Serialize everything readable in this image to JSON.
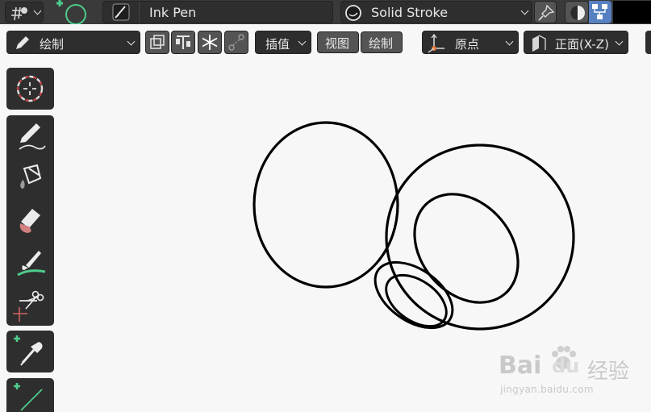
{
  "header": {
    "editor_icon": "grease-pencil-mode-icon",
    "object_icon": "add-circle-icon",
    "brush_icon": "ink-pen-brush-icon",
    "brush_name": "Ink Pen",
    "material_icon": "material-sphere-icon",
    "material_name": "Solid Stroke",
    "pin_icon": "pin-icon",
    "shading_icon": "shading-sphere-icon",
    "overlay_icon": "node-tree-icon"
  },
  "toolbar": {
    "mode_label": "绘制",
    "mode_icon": "pencil-icon",
    "interp_label": "插值",
    "view_label": "视图",
    "draw_label": "绘制",
    "origin_label": "原点",
    "plane_label": "正面(X-Z)"
  },
  "tools": [
    {
      "name": "cursor-tool",
      "icon": "cursor-icon"
    },
    {
      "name": "draw-tool",
      "icon": "pencil-icon"
    },
    {
      "name": "fill-tool",
      "icon": "bucket-icon"
    },
    {
      "name": "erase-tool",
      "icon": "eraser-icon"
    },
    {
      "name": "tint-tool",
      "icon": "brush-icon"
    },
    {
      "name": "cutter-tool",
      "icon": "scissors-icon"
    },
    {
      "name": "eyedropper-tool",
      "icon": "eyedropper-icon"
    },
    {
      "name": "line-tool",
      "icon": "line-icon"
    }
  ],
  "watermark": {
    "brand_left": "Bai",
    "brand_right": "du",
    "brand_cn": "经验",
    "url": "jingyan.baidu.com"
  },
  "colors": {
    "panel": "#2e2e2e",
    "header": "#3a3a3a",
    "accent_blue": "#5680c2",
    "add_green": "#4ecb8c",
    "canvas": "#f7f7f7"
  }
}
